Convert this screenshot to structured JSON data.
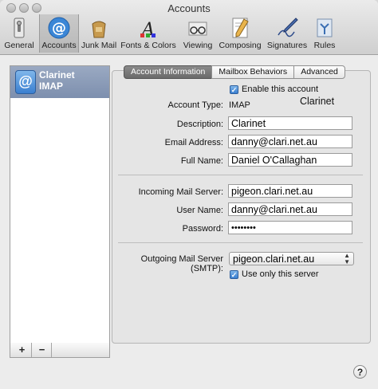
{
  "window": {
    "title": "Accounts"
  },
  "toolbar": {
    "items": [
      {
        "label": "General",
        "icon": "switch-icon"
      },
      {
        "label": "Accounts",
        "icon": "at-sign-icon"
      },
      {
        "label": "Junk Mail",
        "icon": "trash-bag-icon"
      },
      {
        "label": "Fonts & Colors",
        "icon": "fonts-colors-icon"
      },
      {
        "label": "Viewing",
        "icon": "glasses-icon"
      },
      {
        "label": "Composing",
        "icon": "pencil-paper-icon"
      },
      {
        "label": "Signatures",
        "icon": "pen-signature-icon"
      },
      {
        "label": "Rules",
        "icon": "rules-icon"
      }
    ],
    "selected": "Accounts"
  },
  "sidebar": {
    "accounts": [
      {
        "name": "Clarinet",
        "type": "IMAP"
      }
    ],
    "add_label": "+",
    "remove_label": "−"
  },
  "tabs": [
    "Account Information",
    "Mailbox Behaviors",
    "Advanced"
  ],
  "active_tab": "Account Information",
  "form": {
    "enable_label": "Enable this account",
    "enabled": true,
    "account_name_display": "Clarinet",
    "account_type_label": "Account Type:",
    "account_type_value": "IMAP",
    "description_label": "Description:",
    "description_value": "Clarinet",
    "email_label": "Email Address:",
    "email_value": "danny@clari.net.au",
    "fullname_label": "Full Name:",
    "fullname_value": "Daniel O'Callaghan",
    "incoming_label": "Incoming Mail Server:",
    "incoming_value": "pigeon.clari.net.au",
    "username_label": "User Name:",
    "username_value": "danny@clari.net.au",
    "password_label": "Password:",
    "password_value": "••••••••",
    "smtp_label": "Outgoing Mail Server (SMTP):",
    "smtp_value": "pigeon.clari.net.au",
    "only_server_label": "Use only this server",
    "only_server_checked": true
  },
  "help_label": "?"
}
